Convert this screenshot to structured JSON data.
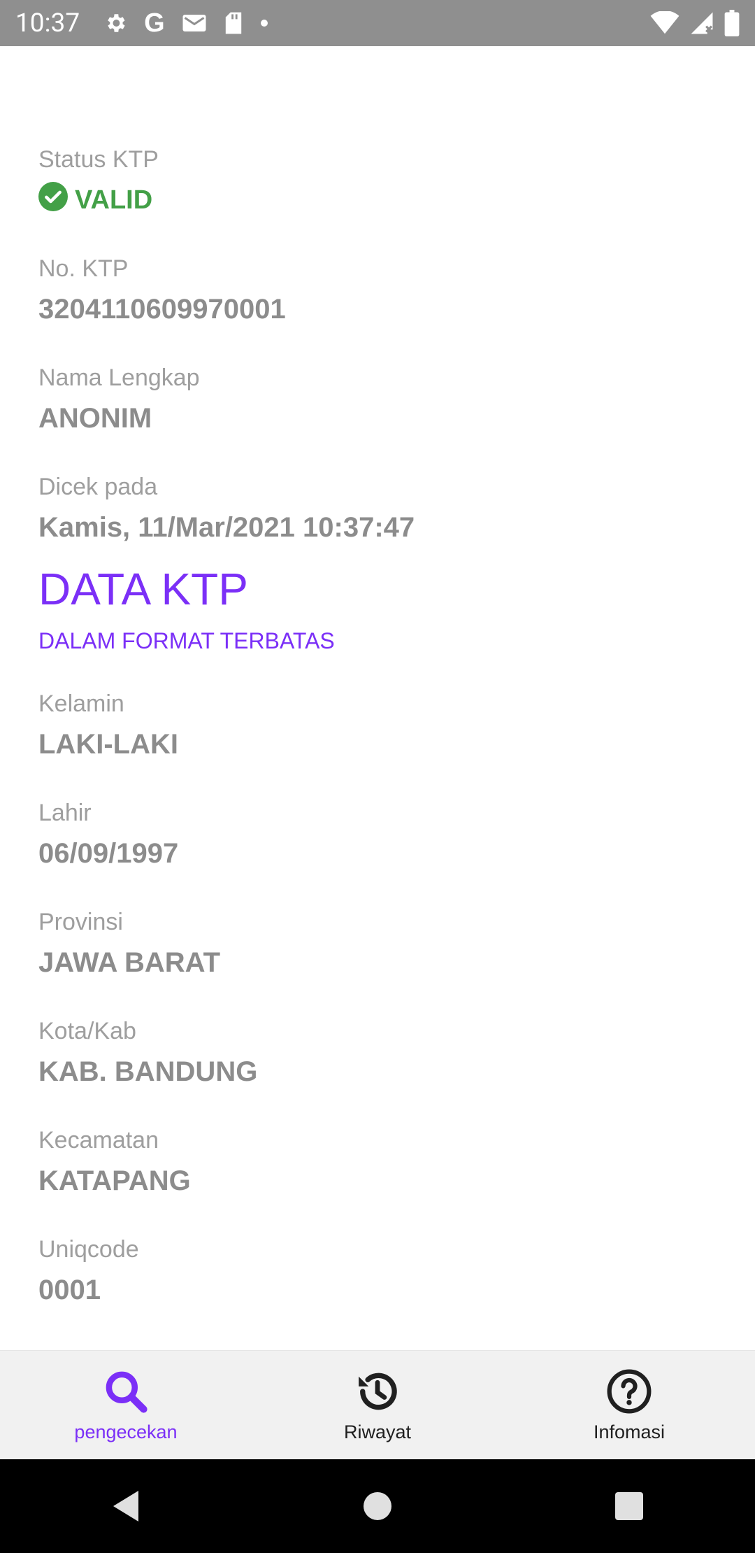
{
  "status_bar": {
    "time": "10:37",
    "left_icons": [
      "gear-icon",
      "google-icon",
      "gmail-icon",
      "sd-card-icon",
      "dot-icon"
    ],
    "right_icons": [
      "wifi-icon",
      "signal-icon",
      "battery-icon"
    ]
  },
  "status": {
    "label": "Status KTP",
    "value": "VALID",
    "color": "#43a047"
  },
  "fields_top": [
    {
      "label": "No. KTP",
      "value": "3204110609970001"
    },
    {
      "label": "Nama Lengkap",
      "value": "ANONIM"
    },
    {
      "label": "Dicek pada",
      "value": "Kamis, 11/Mar/2021 10:37:47"
    }
  ],
  "section": {
    "title": "DATA KTP",
    "subtitle": "DALAM FORMAT TERBATAS",
    "accent": "#7b2ff7"
  },
  "fields_ktp": [
    {
      "label": "Kelamin",
      "value": "LAKI-LAKI"
    },
    {
      "label": "Lahir",
      "value": "06/09/1997"
    },
    {
      "label": "Provinsi",
      "value": "JAWA BARAT"
    },
    {
      "label": "Kota/Kab",
      "value": "KAB. BANDUNG"
    },
    {
      "label": "Kecamatan",
      "value": "KATAPANG"
    },
    {
      "label": "Uniqcode",
      "value": "0001"
    }
  ],
  "bottom_nav": [
    {
      "label": "pengecekan",
      "icon": "search-icon",
      "active": true
    },
    {
      "label": "Riwayat",
      "icon": "history-icon",
      "active": false
    },
    {
      "label": "Infomasi",
      "icon": "help-icon",
      "active": false
    }
  ],
  "system_nav": [
    "back-icon",
    "home-icon",
    "recents-icon"
  ]
}
